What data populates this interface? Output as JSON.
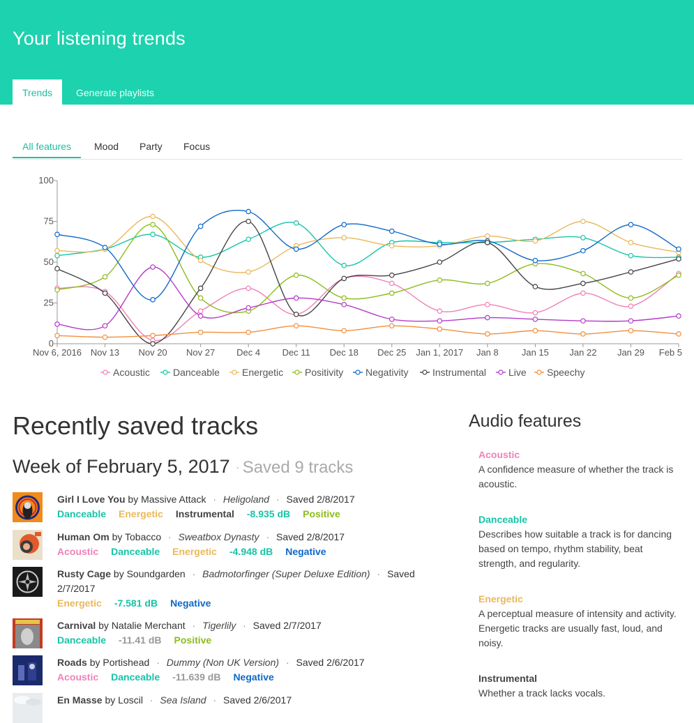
{
  "app": {
    "title": "Your listening trends",
    "tabs": [
      "Trends",
      "Generate playlists"
    ]
  },
  "subtabs": [
    "All features",
    "Mood",
    "Party",
    "Focus"
  ],
  "colors": {
    "brand": "#1dd2ae",
    "Acoustic": "#ef82b8",
    "Danceable": "#16c4a8",
    "Energetic": "#e9b85b",
    "Positivity": "#8dbc1c",
    "Negativity": "#0f68c9",
    "Instrumental": "#444444",
    "Live": "#b43ac8",
    "Speechy": "#f28e3c",
    "Loudness": "#16c4a8",
    "LoudnessQuiet": "#999999"
  },
  "chart_data": {
    "type": "line",
    "categories": [
      "Nov 6, 2016",
      "Nov 13",
      "Nov 20",
      "Nov 27",
      "Dec 4",
      "Dec 11",
      "Dec 18",
      "Dec 25",
      "Jan 1, 2017",
      "Jan 8",
      "Jan 15",
      "Jan 22",
      "Jan 29",
      "Feb 5"
    ],
    "yticks": [
      0,
      25,
      50,
      75,
      100
    ],
    "ylim": [
      0,
      100
    ],
    "legend_position": "bottom",
    "series": [
      {
        "name": "Acoustic",
        "values": [
          34,
          32,
          2,
          20,
          34,
          18,
          40,
          37,
          20,
          24,
          19,
          31,
          23,
          43
        ]
      },
      {
        "name": "Danceable",
        "values": [
          54,
          58,
          67,
          53,
          64,
          74,
          48,
          62,
          62,
          62,
          64,
          65,
          54,
          53
        ]
      },
      {
        "name": "Energetic",
        "values": [
          57,
          58,
          78,
          51,
          44,
          60,
          65,
          60,
          60,
          66,
          63,
          75,
          62,
          56
        ]
      },
      {
        "name": "Positivity",
        "values": [
          33,
          41,
          73,
          28,
          20,
          42,
          28,
          31,
          39,
          37,
          49,
          43,
          28,
          42
        ]
      },
      {
        "name": "Negativity",
        "values": [
          67,
          59,
          27,
          72,
          81,
          58,
          73,
          69,
          61,
          63,
          51,
          57,
          73,
          58
        ]
      },
      {
        "name": "Instrumental",
        "values": [
          46,
          31,
          0,
          34,
          75,
          18,
          40,
          42,
          50,
          62,
          35,
          37,
          44,
          52
        ]
      },
      {
        "name": "Live",
        "values": [
          12,
          11,
          47,
          17,
          22,
          28,
          24,
          15,
          14,
          16,
          15,
          14,
          14,
          17
        ]
      },
      {
        "name": "Speechy",
        "values": [
          5,
          4,
          5,
          7,
          7,
          11,
          8,
          11,
          9,
          6,
          8,
          6,
          8,
          6
        ]
      }
    ]
  },
  "recent": {
    "heading": "Recently saved tracks",
    "week": "Week of February 5, 2017",
    "dot": "·",
    "count": "Saved 9 tracks",
    "tracks": [
      {
        "title": "Girl I Love You",
        "by": "by Massive Attack",
        "album": "Heligoland",
        "saved": "Saved 2/8/2017",
        "tags": [
          {
            "label": "Danceable",
            "kind": "Danceable"
          },
          {
            "label": "Energetic",
            "kind": "Energetic"
          },
          {
            "label": "Instrumental",
            "kind": "Instrumental"
          },
          {
            "label": "-8.935 dB",
            "kind": "Loudness"
          },
          {
            "label": "Positive",
            "kind": "Positivity"
          }
        ]
      },
      {
        "title": "Human Om",
        "by": "by Tobacco",
        "album": "Sweatbox Dynasty",
        "saved": "Saved 2/8/2017",
        "tags": [
          {
            "label": "Acoustic",
            "kind": "Acoustic"
          },
          {
            "label": "Danceable",
            "kind": "Danceable"
          },
          {
            "label": "Energetic",
            "kind": "Energetic"
          },
          {
            "label": "-4.948 dB",
            "kind": "Loudness"
          },
          {
            "label": "Negative",
            "kind": "Negativity"
          }
        ]
      },
      {
        "title": "Rusty Cage",
        "by": "by Soundgarden",
        "album": "Badmotorfinger (Super Deluxe Edition)",
        "saved": "Saved 2/7/2017",
        "tags": [
          {
            "label": "Energetic",
            "kind": "Energetic"
          },
          {
            "label": "-7.581 dB",
            "kind": "Loudness"
          },
          {
            "label": "Negative",
            "kind": "Negativity"
          }
        ]
      },
      {
        "title": "Carnival",
        "by": "by Natalie Merchant",
        "album": "Tigerlily",
        "saved": "Saved 2/7/2017",
        "tags": [
          {
            "label": "Danceable",
            "kind": "Danceable"
          },
          {
            "label": "-11.41 dB",
            "kind": "LoudnessQuiet"
          },
          {
            "label": "Positive",
            "kind": "Positivity"
          }
        ]
      },
      {
        "title": "Roads",
        "by": "by Portishead",
        "album": "Dummy (Non UK Version)",
        "saved": "Saved 2/6/2017",
        "tags": [
          {
            "label": "Acoustic",
            "kind": "Acoustic"
          },
          {
            "label": "Danceable",
            "kind": "Danceable"
          },
          {
            "label": "-11.639 dB",
            "kind": "LoudnessQuiet"
          },
          {
            "label": "Negative",
            "kind": "Negativity"
          }
        ]
      },
      {
        "title": "En Masse",
        "by": "by Loscil",
        "album": "Sea Island",
        "saved": "Saved 2/6/2017",
        "tags": []
      }
    ]
  },
  "audio": {
    "heading": "Audio features",
    "features": [
      {
        "name": "Acoustic",
        "kind": "Acoustic",
        "desc": "A confidence measure of whether the track is acoustic."
      },
      {
        "name": "Danceable",
        "kind": "Danceable",
        "desc": "Describes how suitable a track is for dancing based on tempo, rhythm stability, beat strength, and regularity."
      },
      {
        "name": "Energetic",
        "kind": "Energetic",
        "desc": "A perceptual measure of intensity and activity. Energetic tracks are usually fast, loud, and noisy."
      },
      {
        "name": "Instrumental",
        "kind": "Instrumental",
        "desc": "Whether a track lacks vocals."
      }
    ]
  }
}
